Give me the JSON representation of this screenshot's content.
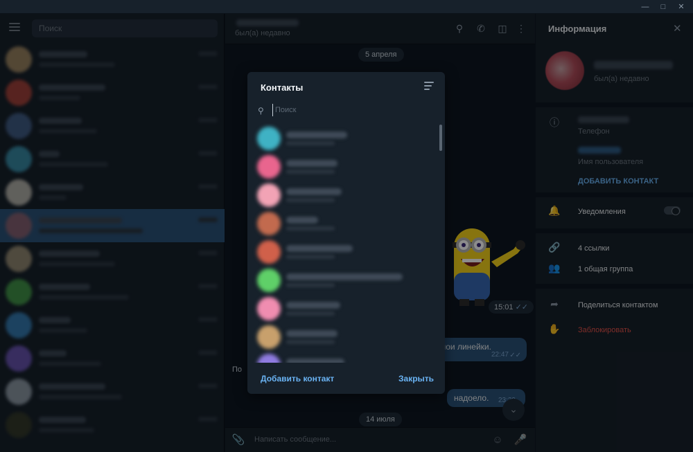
{
  "left": {
    "search_placeholder": "Поиск",
    "chats": [
      {
        "avatar_color": "#b89a6e",
        "active": false
      },
      {
        "avatar_color": "#c24a3f",
        "active": false
      },
      {
        "avatar_color": "#4a6a9a",
        "active": false
      },
      {
        "avatar_color": "#3fa3c2",
        "active": false
      },
      {
        "avatar_color": "#d7d3c8",
        "active": false
      },
      {
        "avatar_color": "#9a6470",
        "active": true
      },
      {
        "avatar_color": "#b0a284",
        "active": false
      },
      {
        "avatar_color": "#4caf50",
        "active": false
      },
      {
        "avatar_color": "#3b8fd0",
        "active": false
      },
      {
        "avatar_color": "#7a5fcf",
        "active": false
      },
      {
        "avatar_color": "#a8b5c2",
        "active": false
      },
      {
        "avatar_color": "#3a3f2a",
        "active": false
      }
    ]
  },
  "center": {
    "status": "был(а) недавно",
    "date1": "5 апреля",
    "sticker_time": "15:01",
    "bubble1_text": "мои линейки.",
    "bubble1_time": "22:47",
    "bubble2_text": "надоело.",
    "bubble2_time": "23:39",
    "date2": "14 июля",
    "composer_placeholder": "Написать сообщение...",
    "partial_left_text": "По"
  },
  "right": {
    "title": "Информация",
    "status": "был(а) недавно",
    "phone_label": "Телефон",
    "username_label": "Имя пользователя",
    "add_contact": "ДОБАВИТЬ КОНТАКТ",
    "notifications": "Уведомления",
    "links": "4 ссылки",
    "groups": "1 общая группа",
    "share": "Поделиться контактом",
    "block": "Заблокировать",
    "colors": {
      "accent": "#6ab3f3",
      "danger": "#e5534b"
    }
  },
  "dialog": {
    "title": "Контакты",
    "search_placeholder": "Поиск",
    "contacts": [
      {
        "color": "#3fb2c4",
        "name_w": 88
      },
      {
        "color": "#e9658e",
        "name_w": 74
      },
      {
        "color": "#f2a3b5",
        "name_w": 80
      },
      {
        "color": "#c26a4e",
        "name_w": 46
      },
      {
        "color": "#d0604a",
        "name_w": 96
      },
      {
        "color": "#5fd068",
        "name_w": 168
      },
      {
        "color": "#f08db0",
        "name_w": 78
      },
      {
        "color": "#c8a06c",
        "name_w": 74
      },
      {
        "color": "#8f7be0",
        "name_w": 84
      }
    ],
    "add_button": "Добавить контакт",
    "close_button": "Закрыть"
  }
}
